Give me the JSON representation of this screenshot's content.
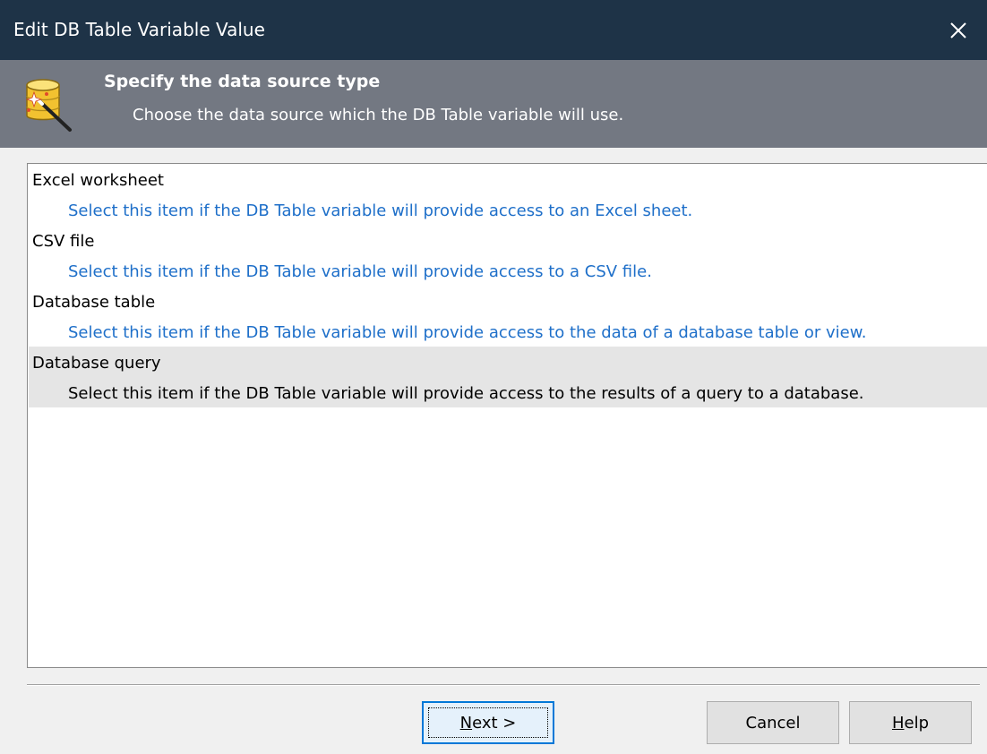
{
  "window": {
    "title": "Edit DB Table Variable Value",
    "close_icon": "close-icon"
  },
  "header": {
    "icon": "database-wizard-icon",
    "title": "Specify the data source type",
    "subtitle": "Choose the data source which the DB Table variable will use."
  },
  "list": {
    "selected_index": 3,
    "items": [
      {
        "label": "Excel worksheet",
        "description": "Select this item if the DB Table variable will provide access to an Excel sheet."
      },
      {
        "label": "CSV file",
        "description": "Select this item if the DB Table variable will provide access to a CSV file."
      },
      {
        "label": "Database table",
        "description": "Select this item if the DB Table variable will provide access to the data of a database table or view."
      },
      {
        "label": "Database query",
        "description": "Select this item if the DB Table variable will provide access to the results of a query to a database."
      }
    ]
  },
  "buttons": {
    "next_mnemonic": "N",
    "next_rest": "ext >",
    "cancel": "Cancel",
    "help_mnemonic": "H",
    "help_rest": "elp"
  },
  "colors": {
    "titlebar": "#1e3347",
    "header": "#737882",
    "description_link": "#1e6fc9",
    "selected_row": "#e5e5e5",
    "default_button_border": "#0078d7"
  }
}
